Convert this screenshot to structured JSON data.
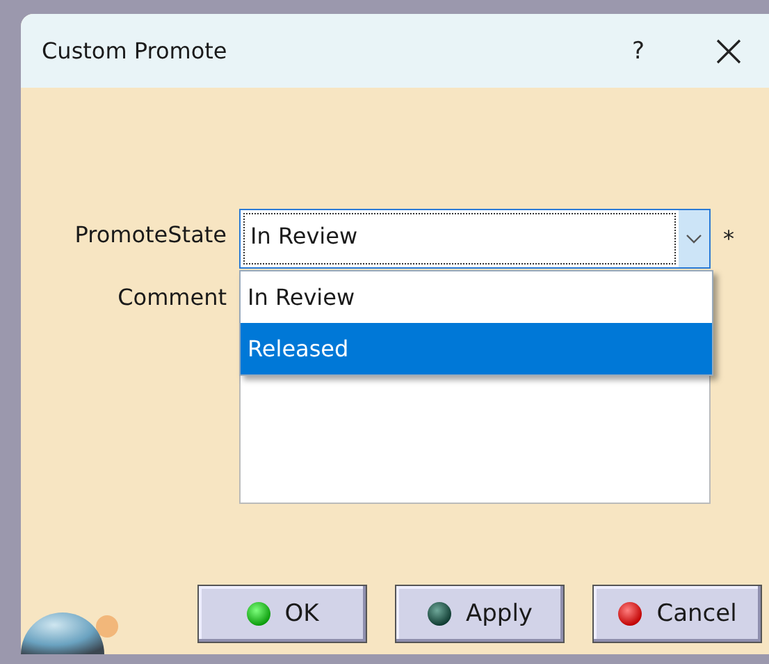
{
  "window": {
    "title": "Custom Promote",
    "help": "?"
  },
  "promote_state": {
    "label": "PromoteState",
    "value": "In Review",
    "required_mark": "*",
    "expanded": true,
    "options": [
      {
        "label": "In Review",
        "highlighted": false
      },
      {
        "label": "Released",
        "highlighted": true
      }
    ]
  },
  "comment": {
    "label": "Comment"
  },
  "buttons": [
    {
      "label": "OK",
      "kind": "ok"
    },
    {
      "label": "Apply",
      "kind": "apply"
    },
    {
      "label": "Cancel",
      "kind": "cancel"
    }
  ]
}
